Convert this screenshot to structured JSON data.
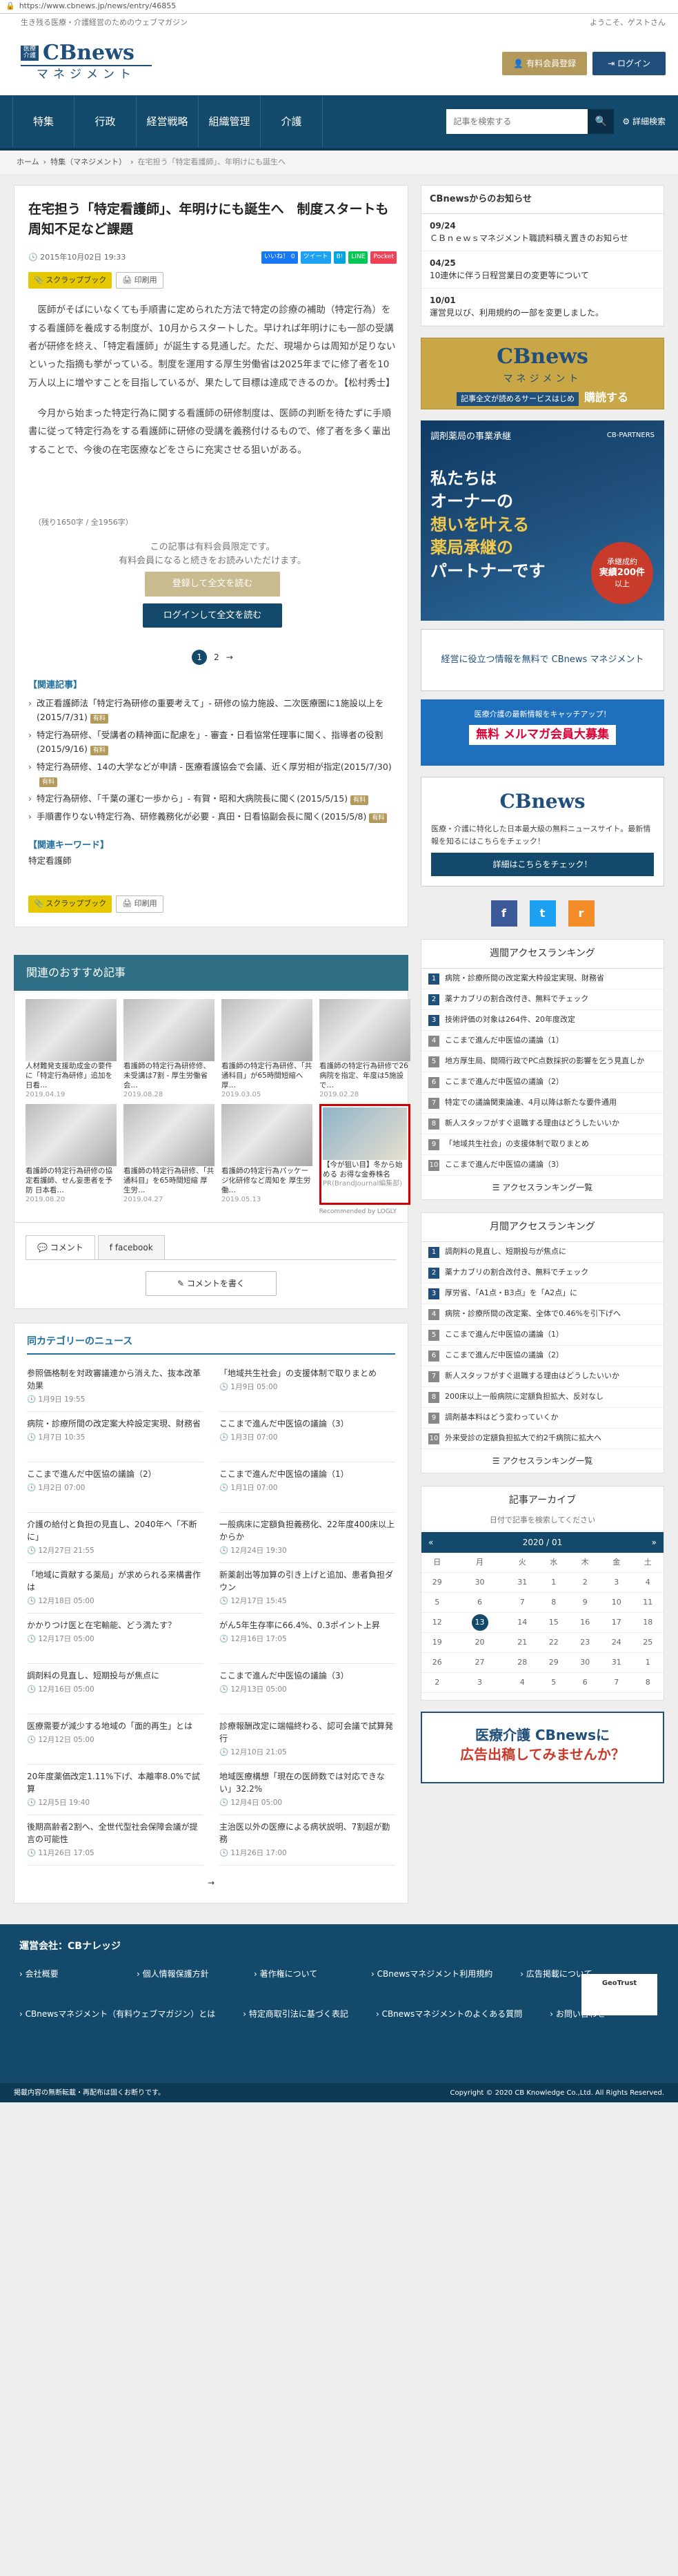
{
  "browser": {
    "url": "https://www.cbnews.jp/news/entry/46855"
  },
  "header": {
    "tagline": "生き残る医療・介護経営のためのウェブマガジン",
    "welcome": "ようこそ、ゲストさん",
    "logo": {
      "tag": "医療介護",
      "name": "CBnews",
      "sub": "マネジメント"
    },
    "member_btn": "有料会員登録",
    "login_btn": "ログイン"
  },
  "nav": {
    "items": [
      "特集",
      "行政",
      "経営戦略",
      "組織管理",
      "介護"
    ],
    "search_placeholder": "記事を検索する",
    "advanced": "詳細検索"
  },
  "breadcrumb": {
    "home": "ホーム",
    "section": "特集（マネジメント）",
    "current": "在宅担う「特定看護師」、年明けにも誕生へ"
  },
  "article": {
    "title": "在宅担う「特定看護師」、年明けにも誕生へ　制度スタートも周知不足など課題",
    "date": "2015年10月02日 19:33",
    "social": [
      "いいね！ 0",
      "ツイート",
      "B!",
      "LINE",
      "Pocket"
    ],
    "scrap": "スクラップブック",
    "print": "印刷用",
    "paragraphs": [
      "医師がそばにいなくても手順書に定められた方法で特定の診療の補助（特定行為）をする看護師を養成する制度が、10月からスタートした。早ければ年明けにも一部の受講者が研修を終え、「特定看護師」が誕生する見通しだ。ただ、現場からは周知が足りないといった指摘も挙がっている。制度を運用する厚生労働省は2025年までに修了者を10万人以上に増やすことを目指しているが、果たして目標は達成できるのか。【松村秀士】",
      "今月から始まった特定行為に関する看護師の研修制度は、医師の判断を待たずに手順書に従って特定行為をする看護師に研修の受講を義務付けるもので、修了者を多く輩出することで、今後の在宅医療などをさらに充実させる狙いがある。"
    ],
    "remain": "（残り1650字 / 全1956字）",
    "members_text1": "この記事は有料会員限定です。",
    "members_text2": "有料会員になると続きをお読みいただけます。",
    "read_btn": "登録して全文を読む",
    "login_read_btn": "ログインして全文を読む",
    "pages": [
      "1",
      "2",
      "→"
    ],
    "related_title": "【関連記事】",
    "related": [
      {
        "text": "改正看護師法「特定行為研修の重要考えて」- 研修の協力施設、二次医療圏に1施設以上を(2015/7/31)",
        "badge": "有料"
      },
      {
        "text": "特定行為研修、「受講者の精神面に配慮を」- 審査・日看協常任理事に聞く、指導者の役割(2015/9/16)",
        "badge": "有料"
      },
      {
        "text": "特定行為研修、14の大学などが申請 - 医療看護協会で会議、近く厚労相が指定(2015/7/30)",
        "badge": "有料"
      },
      {
        "text": "特定行為研修、「千葉の運む一歩から」- 有賀・昭和大病院長に聞く(2015/5/15)",
        "badge": "有料"
      },
      {
        "text": "手順書作りない特定行為、研修義務化が必要 - 真田・日看協副会長に聞く(2015/5/8)",
        "badge": "有料"
      }
    ],
    "keyword_title": "【関連キーワード】",
    "keyword": "特定看護師"
  },
  "recommend": {
    "title": "関連のおすすめ記事",
    "items": [
      {
        "text": "人材難発支援助成金の要件に「特定行為研修」追加を 日看…",
        "date": "2019.04.19"
      },
      {
        "text": "看護師の特定行為研修修、未受講は7割 - 厚生労働省会…",
        "date": "2019.08.28"
      },
      {
        "text": "看護師の特定行為研修、「共通科目」が65時間短縮へ 厚…",
        "date": "2019.03.05"
      },
      {
        "text": "看護師の特定行為研修で26病院を指定、年度は5施設で…",
        "date": "2019.02.28"
      },
      {
        "text": "看護師の特定行為研修の協定看護師、せん妄患者を予防 日本看…",
        "date": "2019.08.20"
      },
      {
        "text": "看護師の特定行為研修、「共通科目」を65時間短縮 厚生労…",
        "date": "2019.04.27"
      },
      {
        "text": "看護師の特定行為パッケージ化研修など周知を 厚生労働…",
        "date": "2019.05.13"
      },
      {
        "text": "【今が狙い目】冬から始める お得な金券株名",
        "date": "PR(BrandJournal編集部)"
      }
    ],
    "by": "Recommended by LOGLY"
  },
  "comments": {
    "tab1": "コメント",
    "tab2": "facebook",
    "btn": "コメントを書く"
  },
  "same_news": {
    "title": "同カテゴリーのニュース",
    "items": [
      {
        "title": "参照価格制を対政審議連から消えた、抜本改革効果",
        "time": "1月9日 19:55"
      },
      {
        "title": "「地域共生社会」の支援体制で取りまとめ",
        "time": "1月9日 05:00"
      },
      {
        "title": "病院・診療所間の改定案大枠設定実現、財務省",
        "time": "1月7日 10:35"
      },
      {
        "title": "ここまで進んだ中医協の議論（3）",
        "time": "1月3日 07:00"
      },
      {
        "title": "ここまで進んだ中医協の議論（2）",
        "time": "1月2日 07:00"
      },
      {
        "title": "ここまで進んだ中医協の議論（1）",
        "time": "1月1日 07:00"
      },
      {
        "title": "介護の給付と負担の見直し、2040年へ「不断に」",
        "time": "12月27日 21:55"
      },
      {
        "title": "一般病床に定額負担義務化、22年度400床以上からか",
        "time": "12月24日 19:30"
      },
      {
        "title": "「地域に貢献する薬局」が求められる来構書作は",
        "time": "12月18日 05:00"
      },
      {
        "title": "新薬創出等加算の引き上げと追加、患者負担ダウン",
        "time": "12月17日 15:45"
      },
      {
        "title": "かかりつけ医と在宅輸能、どう満たす？",
        "time": "12月17日 05:00"
      },
      {
        "title": "がん5年生存率に66.4%、0.3ポイント上昇",
        "time": "12月16日 17:05"
      },
      {
        "title": "調剤料の見直し、短期投与が焦点に",
        "time": "12月16日 05:00"
      },
      {
        "title": "ここまで進んだ中医協の議論（3）",
        "time": "12月13日 05:00"
      },
      {
        "title": "医療需要が減少する地域の「面的再生」とは",
        "time": "12月12日 05:00"
      },
      {
        "title": "診療報酬改定に端幅終わる、認可会議で試算発行",
        "time": "12月10日 21:05"
      },
      {
        "title": "20年度薬価改定1.11%下げ、本離率8.0%で試算",
        "time": "12月5日 19:40"
      },
      {
        "title": "地域医療構想「現在の医師数では対応できない」32.2%",
        "time": "12月4日 05:00"
      },
      {
        "title": "後期高齢者2割へ、全世代型社会保障会議が提言の可能性",
        "time": "11月26日 17:05"
      },
      {
        "title": "主治医以外の医療による病状説明、7割超が勤務",
        "time": "11月26日 17:00"
      }
    ],
    "pager": "→"
  },
  "side": {
    "notice_title": "CBnewsからのお知らせ",
    "notices": [
      {
        "date": "09/24",
        "text": "ＣＢｎｅｗｓマネジメント職読料積え置きのお知らせ"
      },
      {
        "date": "04/25",
        "text": "10連休に伴う日程営業日の変更等について"
      },
      {
        "date": "10/01",
        "text": "運営見以び、利用規約の一部を変更しました。"
      }
    ],
    "banner1": {
      "name": "CBnews",
      "sub": "マネジメント",
      "copy": "記事全文が読めるサービスはじめ",
      "cta": "購読する"
    },
    "ad2": {
      "head": "調剤薬局の事業承継",
      "brand": "CB-PARTNERS",
      "big1": "私たちは",
      "big2": "オーナーの",
      "big3": "想いを叶える",
      "big4": "薬局承継の",
      "big5": "パートナーです",
      "badge1": "承継成約",
      "badge2": "実績200件",
      "badge3": "以上"
    },
    "ad3": {
      "text": "経営に役立つ情報を無料で CBnews マネジメント"
    },
    "ad4": {
      "line1": "医療介護の最新情報をキャッチアップ！",
      "line2": "無料 メルマガ会員大募集"
    },
    "cb_box": {
      "name": "CBnews",
      "desc": "医療・介護に特化した日本最大級の無料ニュースサイト。最新情報を知るにはこちらをチェック！",
      "btn": "詳細はこちらをチェック！"
    },
    "sns": [
      "f",
      "t",
      "r"
    ],
    "rank_week": {
      "title": "週間アクセスランキング",
      "items": [
        "病院・診療所間の改定案大枠設定実現、財務省",
        "薬ナカブリの割合改付き、無料でチェック",
        "技術評価の対象は264件、20年度改定",
        "ここまで進んだ中医協の議論（1）",
        "地方厚生局、間隔行政でPC点数採択の影響を乞う見直しか",
        "ここまで進んだ中医協の議論（2）",
        "特定での議論関東論連、4月以降は新たな要件通用",
        "新人スタッフがすぐ退職する理由はどうしたいいか",
        "「地域共生社会」の支援体制で取りまとめ",
        "ここまで進んだ中医協の議論（3）"
      ],
      "more": "アクセスランキング一覧"
    },
    "rank_month": {
      "title": "月間アクセスランキング",
      "items": [
        "調剤料の見直し、短期投与が焦点に",
        "薬ナカブリの割合改付き、無料でチェック",
        "厚労省、「A1点・B3点」を「A2点」に",
        "病院・診療所間の改定案、全体で0.46%を引下げへ",
        "ここまで進んだ中医協の議論（1）",
        "ここまで進んだ中医協の議論（2）",
        "新人スタッフがすぐ退職する理由はどうしたいいか",
        "200床以上一般病院に定額負担拡大、反対なし",
        "調剤基本料はどう変わっていくか",
        "外来受診の定額負担拡大で約2千病院に拡大へ"
      ],
      "more": "アクセスランキング一覧"
    },
    "archive": {
      "title": "記事アーカイブ",
      "sub": "日付で記事を検索してください",
      "prev": "«",
      "month": "2020 / 01",
      "next": "»",
      "week": [
        "日",
        "月",
        "火",
        "水",
        "木",
        "金",
        "土"
      ],
      "days": [
        [
          "29",
          "30",
          "31",
          "1",
          "2",
          "3",
          "4"
        ],
        [
          "5",
          "6",
          "7",
          "8",
          "9",
          "10",
          "11"
        ],
        [
          "12",
          "13",
          "14",
          "15",
          "16",
          "17",
          "18"
        ],
        [
          "19",
          "20",
          "21",
          "22",
          "23",
          "24",
          "25"
        ],
        [
          "26",
          "27",
          "28",
          "29",
          "30",
          "31",
          "1"
        ],
        [
          "2",
          "3",
          "4",
          "5",
          "6",
          "7",
          "8"
        ]
      ],
      "today": "13"
    },
    "ad5": {
      "line1": "医療介護 CBnewsに",
      "line2": "広告出稿してみませんか？"
    }
  },
  "footer": {
    "company": "運営会社：CBナレッジ",
    "links": [
      "会社概要",
      "個人情報保護方針",
      "著作権について",
      "CBnewsマネジメント利用規約",
      "広告掲載について",
      "CBnewsマネジメント（有料ウェブマガジン）とは",
      "特定商取引法に基づく表記",
      "CBnewsマネジメントのよくある質問",
      "お問い合わせ"
    ],
    "gt": "GeoTrust",
    "copyright": "Copyright © 2020 CB Knowledge Co.,Ltd. All Rights Reserved.",
    "left_note": "掲載内容の無断転載・再配布は固くお断りです。"
  },
  "colors": {
    "navy": "#134a6b",
    "gold": "#b39a5c",
    "accent": "#1f6f9f"
  }
}
